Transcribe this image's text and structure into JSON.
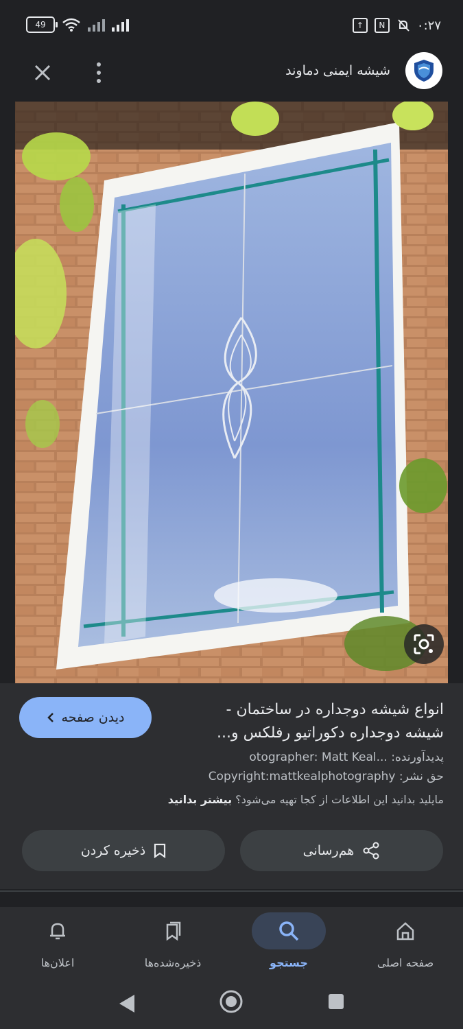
{
  "status_bar": {
    "battery": "49",
    "time": "۰:۲۷"
  },
  "app_bar": {
    "site_title": "شیشه ایمنی دماوند",
    "icons": [
      "close-icon",
      "more-vert-icon",
      "site-logo"
    ]
  },
  "result": {
    "title": "انواع شیشه دوجداره در ساختمان - شیشه دوجداره دکوراتیو رفلکس و...",
    "visit_label": "دیدن صفحه",
    "creator_label": "پدیدآورنده:",
    "creator_value": "otographer: Matt Keal...",
    "copyright_label": "حق نشر:",
    "copyright_value": "Copyright:mattkealphotography",
    "notice_text": "مایلید بدانید این اطلاعات از کجا تهیه می‌شود؟",
    "notice_link": "بیشتر بدانید",
    "share_label": "هم‌رسانی",
    "save_label": "ذخیره کردن"
  },
  "bottom_nav": {
    "items": [
      {
        "label": "اعلان‌ها",
        "icon": "bell-icon"
      },
      {
        "label": "ذخیره‌شده‌ها",
        "icon": "bookmarks-icon"
      },
      {
        "label": "جستجو",
        "icon": "search-icon",
        "active": true
      },
      {
        "label": "صفحه اصلی",
        "icon": "home-icon"
      }
    ]
  },
  "colors": {
    "background": "#202124",
    "panel": "#2d2e31",
    "accent": "#8ab4f8",
    "pill": "#3c4043"
  }
}
